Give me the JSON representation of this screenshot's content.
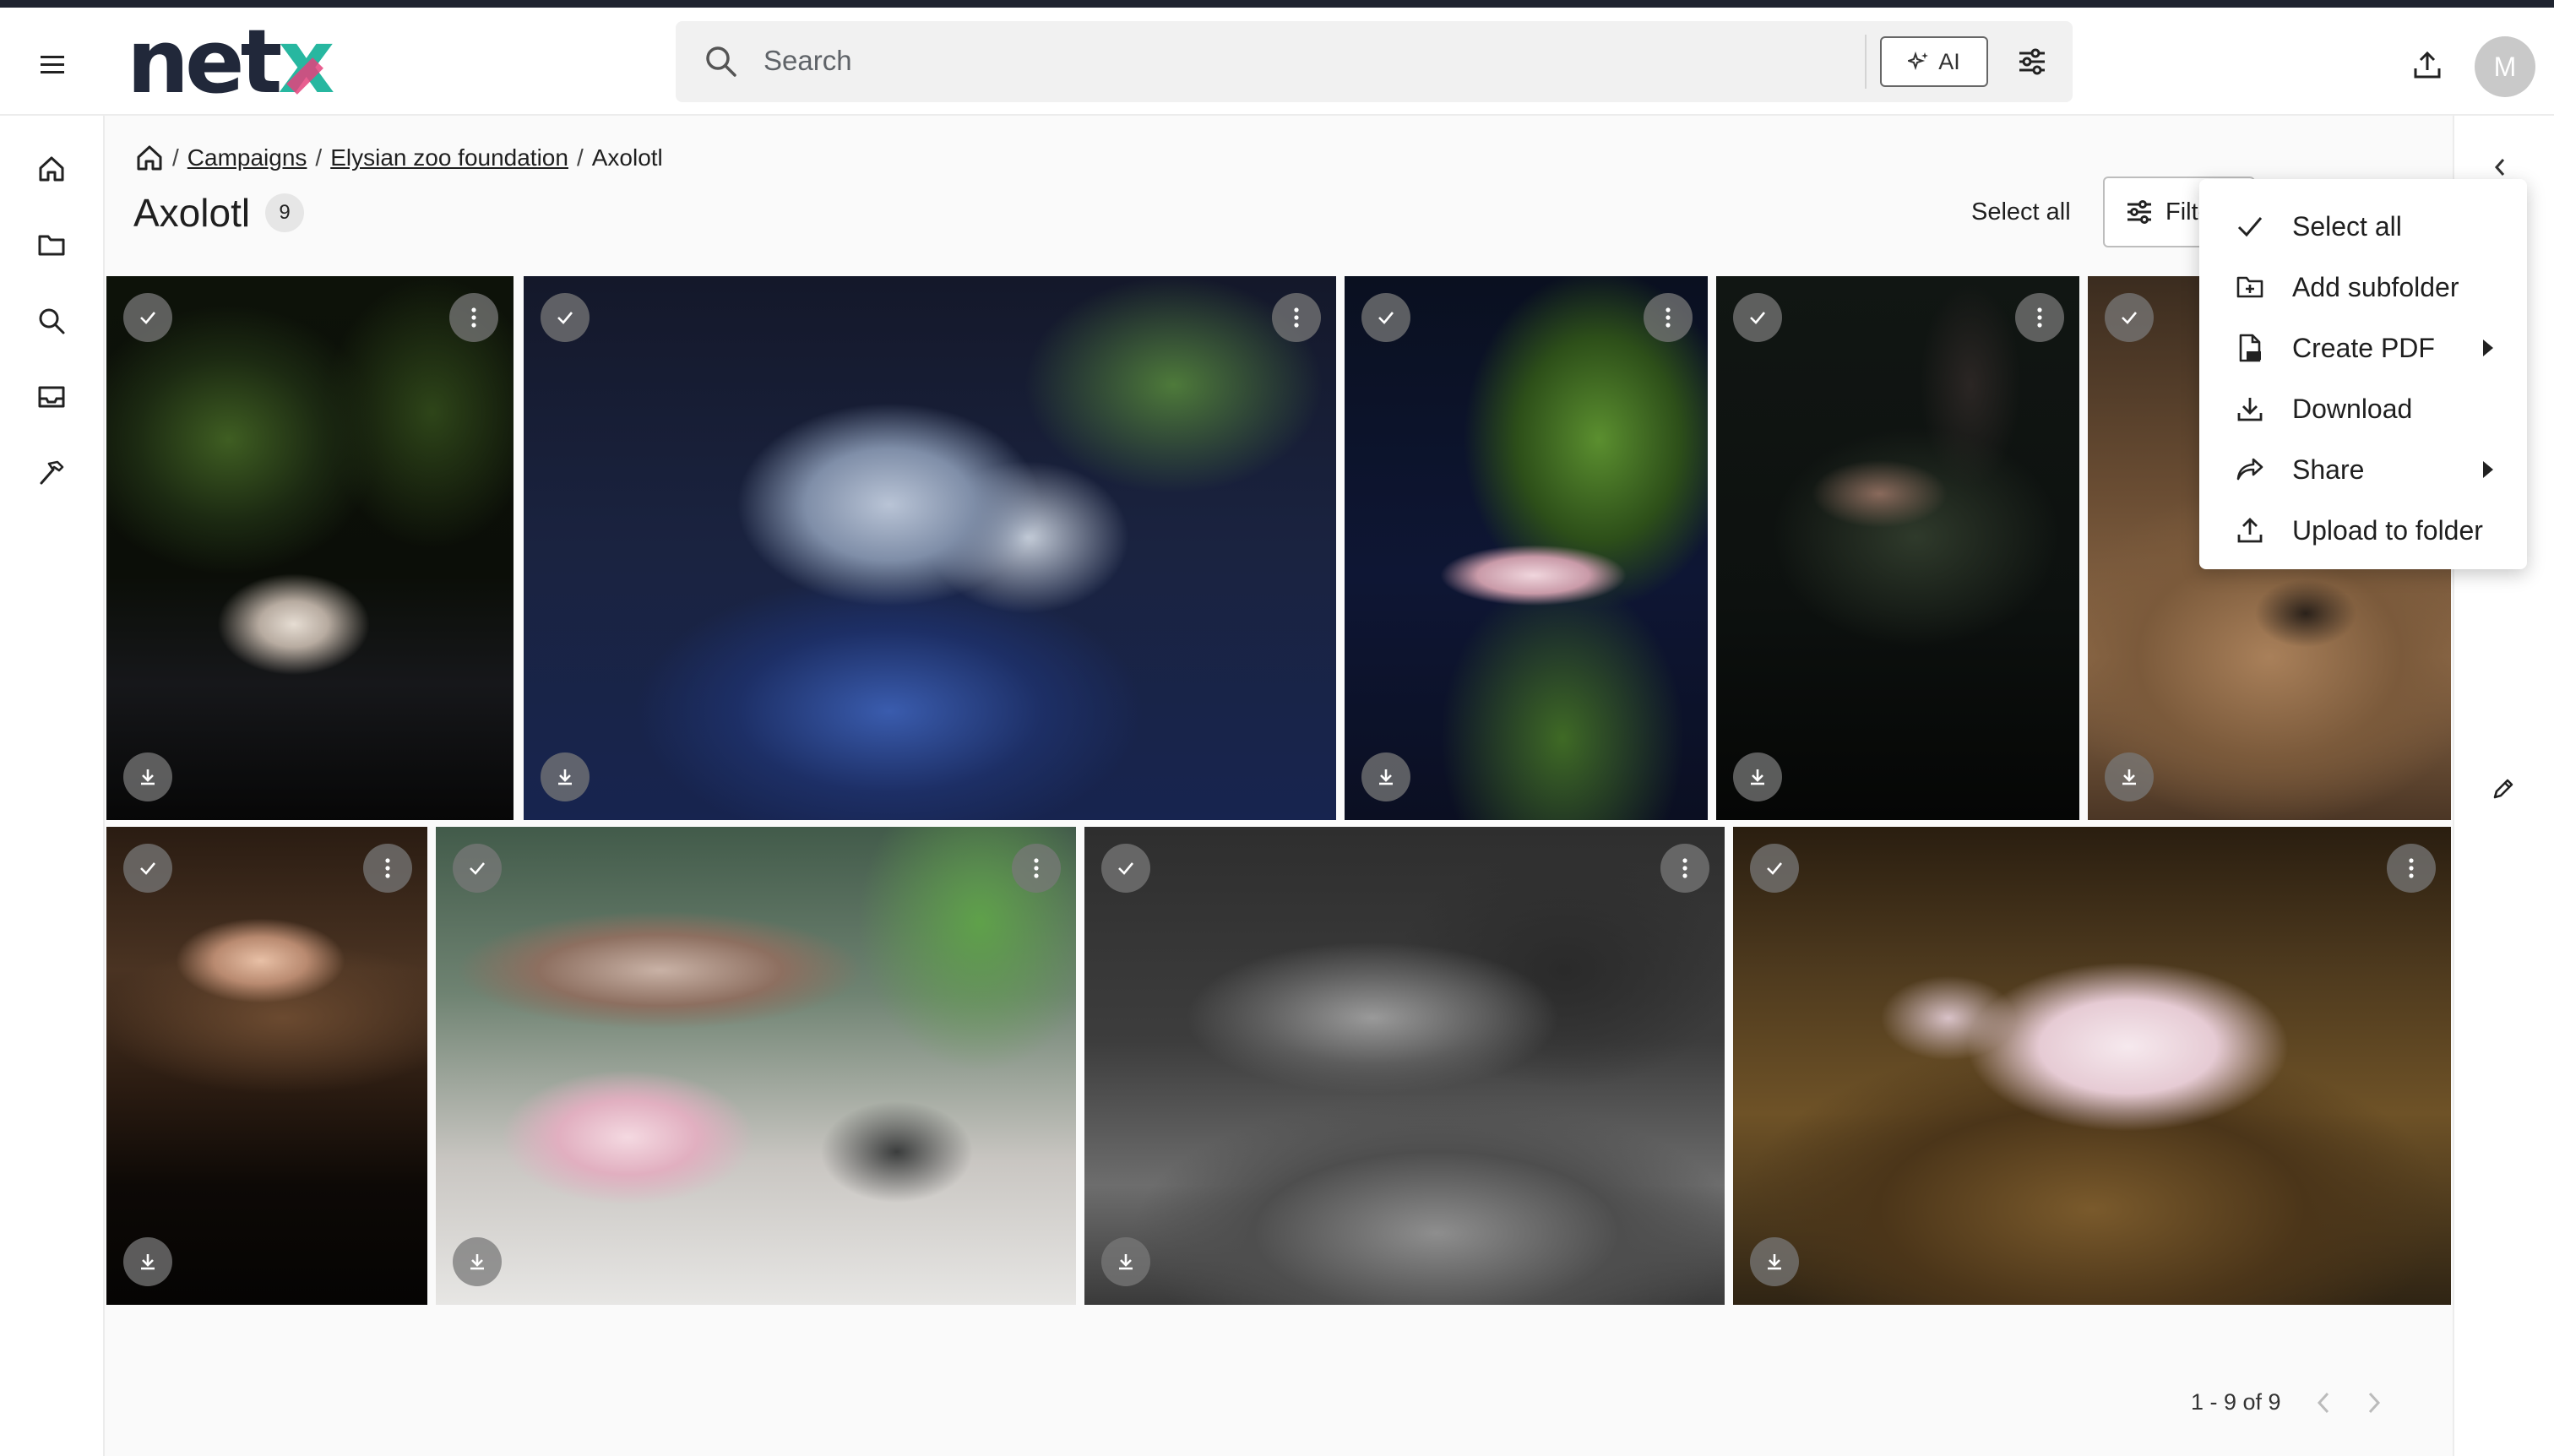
{
  "app": {
    "logo_main": "net",
    "logo_accent": "x"
  },
  "header": {
    "search_placeholder": "Search",
    "ai_label": "AI",
    "avatar_initial": "M"
  },
  "breadcrumb": {
    "items": [
      "Campaigns",
      "Elysian zoo foundation"
    ],
    "current": "Axolotl",
    "separator": "/"
  },
  "page": {
    "title": "Axolotl",
    "count": "9",
    "select_all_label": "Select all",
    "filter_label": "Filter"
  },
  "context_menu": {
    "items": [
      {
        "label": "Select all",
        "icon": "check-icon"
      },
      {
        "label": "Add subfolder",
        "icon": "add-folder-icon"
      },
      {
        "label": "Create PDF",
        "icon": "pdf-icon",
        "submenu": true
      },
      {
        "label": "Download",
        "icon": "download-icon"
      },
      {
        "label": "Share",
        "icon": "share-icon",
        "submenu": true
      },
      {
        "label": "Upload to folder",
        "icon": "upload-icon"
      }
    ]
  },
  "tiles": [
    {
      "id": 1,
      "bg": "dark green"
    },
    {
      "id": 2,
      "bg": "blue"
    },
    {
      "id": 3,
      "bg": "blue green"
    },
    {
      "id": 4,
      "bg": "dark"
    },
    {
      "id": 5,
      "bg": "sand"
    },
    {
      "id": 6,
      "bg": "brown"
    },
    {
      "id": 7,
      "bg": "white sand"
    },
    {
      "id": 8,
      "bg": "grayscale"
    },
    {
      "id": 9,
      "bg": "brown gravel"
    }
  ],
  "pagination": {
    "range_label": "1 - 9 of 9"
  },
  "colors": {
    "brand_dark": "#21283a",
    "brand_teal": "#27b7a0",
    "brand_pink": "#e5427d"
  }
}
